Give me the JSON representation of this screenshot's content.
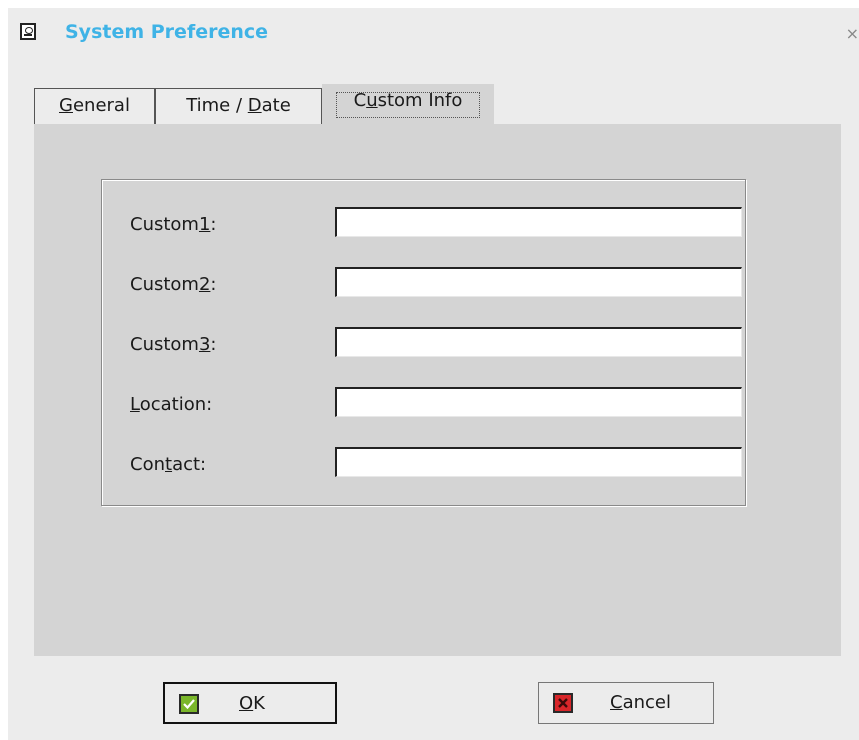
{
  "window": {
    "title": "System Preference",
    "close_glyph": "×"
  },
  "tabs": [
    {
      "pre": "",
      "mnemonic": "G",
      "post": "eneral",
      "selected": false
    },
    {
      "pre": "Time / ",
      "mnemonic": "D",
      "post": "ate",
      "selected": false
    },
    {
      "pre": "C",
      "mnemonic": "u",
      "post": "stom Info",
      "selected": true
    }
  ],
  "fields": [
    {
      "pre": "Custom",
      "mnemonic": "1",
      "post": ":",
      "value": ""
    },
    {
      "pre": "Custom",
      "mnemonic": "2",
      "post": ":",
      "value": ""
    },
    {
      "pre": "Custom",
      "mnemonic": "3",
      "post": ":",
      "value": ""
    },
    {
      "pre": "",
      "mnemonic": "L",
      "post": "ocation:",
      "value": ""
    },
    {
      "pre": "Con",
      "mnemonic": "t",
      "post": "act:",
      "value": ""
    }
  ],
  "buttons": {
    "ok": {
      "pre": "",
      "mnemonic": "O",
      "post": "K",
      "icon": "check-icon"
    },
    "cancel": {
      "pre": "",
      "mnemonic": "C",
      "post": "ancel",
      "icon": "x-icon"
    }
  },
  "colors": {
    "title": "#3fb3e6",
    "panel": "#d4d4d4",
    "ok_icon": "#7ab62a",
    "cancel_icon": "#d8262a"
  }
}
